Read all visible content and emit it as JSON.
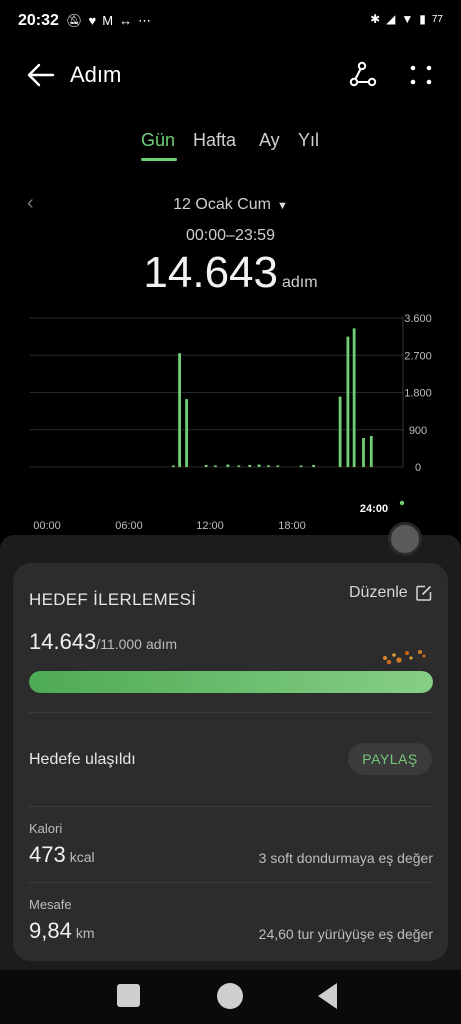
{
  "status_bar": {
    "time": "20:32",
    "left_icons": [
      "bell-off-icon",
      "heart-app-icon",
      "gmail-icon",
      "link-icon",
      "more-dots-icon"
    ],
    "battery": "77"
  },
  "app_bar": {
    "title": "Adım"
  },
  "tabs": [
    {
      "label": "Gün",
      "active": true
    },
    {
      "label": "Hafta",
      "active": false
    },
    {
      "label": "Ay",
      "active": false
    },
    {
      "label": "Yıl",
      "active": false
    }
  ],
  "date": {
    "label": "12 Ocak Cum",
    "range": "00:00–23:59"
  },
  "summary": {
    "steps": "14.643",
    "unit": "adım"
  },
  "chart_data": {
    "type": "bar",
    "x_tick_labels": [
      "00:00",
      "06:00",
      "12:00",
      "18:00",
      "24:00"
    ],
    "y_tick_labels": [
      "3.600",
      "2.700",
      "1.800",
      "900",
      "0"
    ],
    "ylim": [
      0,
      3600
    ],
    "x_domain_hours": [
      0,
      24
    ],
    "grid": true,
    "bars": [
      {
        "hour": 9.2,
        "value": 30
      },
      {
        "hour": 9.6,
        "value": 2750
      },
      {
        "hour": 10.05,
        "value": 1640
      },
      {
        "hour": 11.3,
        "value": 50
      },
      {
        "hour": 11.9,
        "value": 30
      },
      {
        "hour": 12.7,
        "value": 60
      },
      {
        "hour": 13.4,
        "value": 30
      },
      {
        "hour": 14.1,
        "value": 50
      },
      {
        "hour": 14.7,
        "value": 60
      },
      {
        "hour": 15.3,
        "value": 40
      },
      {
        "hour": 15.9,
        "value": 30
      },
      {
        "hour": 17.4,
        "value": 30
      },
      {
        "hour": 18.2,
        "value": 50
      },
      {
        "hour": 19.9,
        "value": 1700
      },
      {
        "hour": 20.4,
        "value": 3150
      },
      {
        "hour": 20.8,
        "value": 3350
      },
      {
        "hour": 21.4,
        "value": 700
      },
      {
        "hour": 21.9,
        "value": 750
      }
    ],
    "colors": {
      "bar": "#6fcf75",
      "grid": "#2a2a2a",
      "tick": "#bdbdbd"
    }
  },
  "goal": {
    "title": "HEDEF İLERLEMESİ",
    "edit_label": "Düzenle",
    "current": "14.643",
    "target": "11.000",
    "unit": "adım",
    "progress": 1.0,
    "reached_label": "Hedefe ulaşıldı",
    "share_label": "PAYLAŞ"
  },
  "stats": [
    {
      "label": "Kalori",
      "value": "473",
      "unit": "kcal",
      "note": "3 soft dondurmaya eş değer"
    },
    {
      "label": "Mesafe",
      "value": "9,84",
      "unit": "km",
      "note": "24,60 tur yürüyüşe eş değer"
    }
  ],
  "colors": {
    "accent": "#6fcf75",
    "background": "#000000",
    "card": "#2c2c2c"
  }
}
